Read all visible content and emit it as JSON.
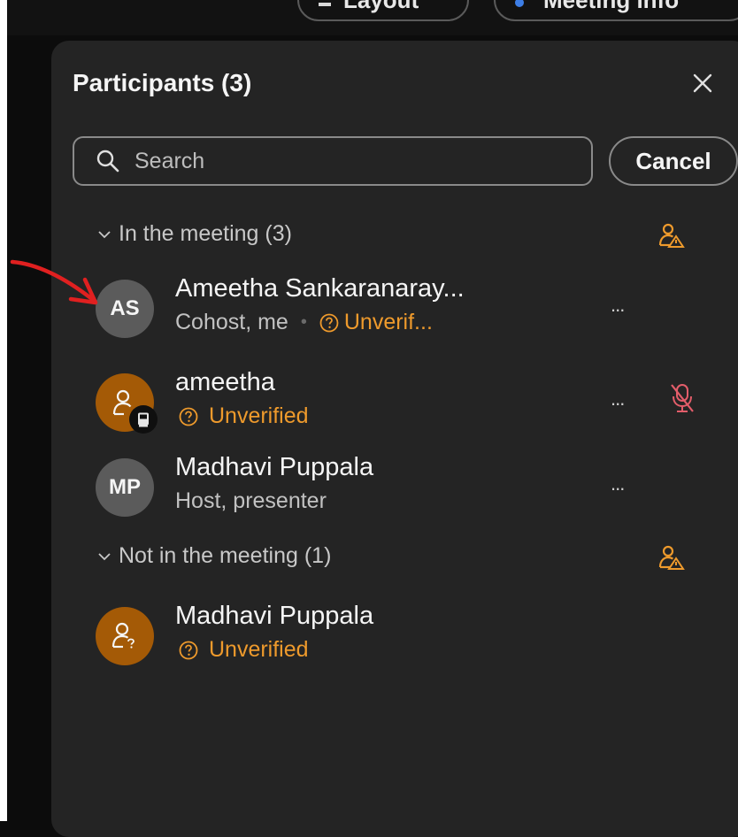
{
  "top_bar": {
    "layout_label": "Layout",
    "meeting_info_label": "Meeting info"
  },
  "panel": {
    "title": "Participants (3)",
    "search": {
      "placeholder": "Search",
      "value": ""
    },
    "cancel_label": "Cancel"
  },
  "sections": {
    "in_meeting": {
      "label": "In the meeting (3)",
      "participants": [
        {
          "initials": "AS",
          "name": "Ameetha Sankaranaray...",
          "role": "Cohost, me",
          "status": "Unverif..."
        },
        {
          "initials": "",
          "name": "ameetha",
          "role": "",
          "status": "Unverified"
        },
        {
          "initials": "MP",
          "name": "Madhavi Puppala",
          "role": "Host, presenter",
          "status": ""
        }
      ]
    },
    "not_in_meeting": {
      "label": "Not in the meeting (1)",
      "participants": [
        {
          "initials": "",
          "name": "Madhavi Puppala",
          "role": "",
          "status": "Unverified"
        }
      ]
    }
  },
  "icons": {
    "more": "...",
    "separator": "•"
  },
  "colors": {
    "panel_bg": "#242424",
    "accent_orange": "#ee9a2c",
    "avatar_orange": "#a45a06",
    "avatar_gray": "#5b5b5b",
    "mute_red": "#e35d6a",
    "annotation_arrow": "#e02020"
  }
}
